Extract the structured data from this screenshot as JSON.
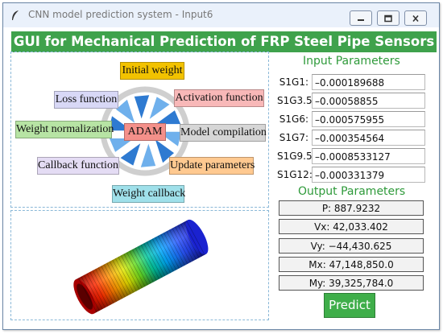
{
  "window": {
    "title": "CNN model prediction system - Input6",
    "icon": "feather-icon"
  },
  "titlebar_buttons": [
    "minimize-icon",
    "maximize-icon",
    "close-icon"
  ],
  "banner": {
    "text": "GUI for Mechanical Prediction of FRP Steel Pipe  Sensors"
  },
  "diagram": {
    "center": "ADAM",
    "nodes": [
      {
        "label": "Initial weight",
        "color": "#f2c200"
      },
      {
        "label": "Activation function",
        "color": "#f8b8b8"
      },
      {
        "label": "Model compilation",
        "color": "#d6d6d6"
      },
      {
        "label": "Update parameters",
        "color": "#ffc990"
      },
      {
        "label": "Weight callback",
        "color": "#9fe0ea"
      },
      {
        "label": "Callback function",
        "color": "#e4dcf4"
      },
      {
        "label": "Weight normalization",
        "color": "#b7e4a4"
      },
      {
        "label": "Loss function",
        "color": "#d8d8f6"
      }
    ],
    "center_color": "#f4908a"
  },
  "input_parameters": {
    "title": "Input Parameters",
    "fields": [
      {
        "label": "S1G1:",
        "value": "–0.000189688"
      },
      {
        "label": "S1G3.5:",
        "value": "–0.00058855"
      },
      {
        "label": "S1G6:",
        "value": "–0.000575955"
      },
      {
        "label": "S1G7:",
        "value": "–0.000354564"
      },
      {
        "label": "S1G9.5:",
        "value": "–0.0008533127"
      },
      {
        "label": "S1G12:",
        "value": "–0.000331379"
      }
    ]
  },
  "output_parameters": {
    "title": "Output Parameters",
    "values": [
      "P: 887.9232",
      "Vx: 42,033.402",
      "Vy: −44,430.625",
      "Mx: 47,148,850.0",
      "My: 39,325,784.0"
    ]
  },
  "predict_button": {
    "label": "Predict",
    "color": "#3fae4a"
  },
  "colors": {
    "accent": "#3fa24c",
    "section_title": "#2e9a3a"
  }
}
